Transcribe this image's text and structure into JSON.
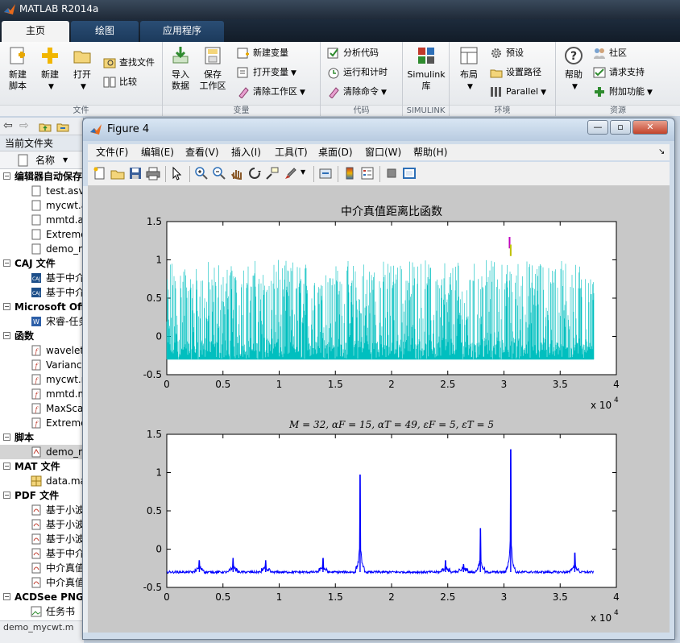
{
  "app": {
    "title": "MATLAB R2014a"
  },
  "tabs": [
    "主页",
    "绘图",
    "应用程序"
  ],
  "ribbon": {
    "file": {
      "label": "文件",
      "new_script": "新建\n脚本",
      "new": "新建",
      "open": "打开",
      "find_files": "查找文件",
      "compare": "比较"
    },
    "variable": {
      "label": "变量",
      "import": "导入\n数据",
      "save_ws": "保存\n工作区",
      "new_var": "新建变量",
      "open_var": "打开变量",
      "clear_ws": "清除工作区"
    },
    "code": {
      "label": "代码",
      "analyze": "分析代码",
      "run_time": "运行和计时",
      "clear_cmd": "清除命令"
    },
    "simulink": {
      "label": "SIMULINK",
      "lib": "Simulink\n库"
    },
    "env": {
      "label": "环境",
      "layout": "布局",
      "prefs": "预设",
      "set_path": "设置路径",
      "parallel": "Parallel"
    },
    "resources": {
      "label": "资源",
      "help": "帮助",
      "community": "社区",
      "support": "请求支持",
      "addons": "附加功能"
    }
  },
  "left_panel": {
    "title": "当前文件夹",
    "column": "名称",
    "groups": [
      {
        "name": "编辑器自动保存",
        "items": [
          "test.asv",
          "mycwt.a",
          "mmtd.a",
          "Extreme",
          "demo_m"
        ]
      },
      {
        "name": "CAJ 文件",
        "items": [
          "基于中介",
          "基于中介"
        ]
      },
      {
        "name": "Microsoft Off",
        "items": [
          "宋睿-任务"
        ]
      },
      {
        "name": "函数",
        "items": [
          "wavelet",
          "Varianc",
          "mycwt.m",
          "mmtd.m",
          "MaxSca",
          "Extreme"
        ]
      },
      {
        "name": "脚本",
        "items": [
          "demo_m"
        ]
      },
      {
        "name": "MAT 文件",
        "items": [
          "data.ma"
        ]
      },
      {
        "name": "PDF 文件",
        "items": [
          "基于小波",
          "基于小波",
          "基于小波",
          "基于中介",
          "中介真值",
          "中介真值"
        ]
      },
      {
        "name": "ACDSee PNG",
        "items": [
          "任务书"
        ]
      }
    ],
    "selected_group": 4,
    "status": "demo_mycwt.m"
  },
  "figure": {
    "title": "Figure 4",
    "menus": [
      "文件(F)",
      "编辑(E)",
      "查看(V)",
      "插入(I)",
      "工具(T)",
      "桌面(D)",
      "窗口(W)",
      "帮助(H)"
    ],
    "window_buttons": {
      "min": "—",
      "max": "▫",
      "close": "✕"
    }
  },
  "chart_data": [
    {
      "type": "line",
      "title": "中介真值距离比函数",
      "xlabel": "",
      "ylabel": "",
      "xlim": [
        0,
        40000
      ],
      "ylim": [
        -0.5,
        1.5
      ],
      "x_ticks": [
        "0",
        "0.5",
        "1",
        "1.5",
        "2",
        "2.5",
        "3",
        "3.5",
        "4"
      ],
      "y_ticks": [
        "-0.5",
        "0",
        "0.5",
        "1",
        "1.5"
      ],
      "x_exponent": "x 10",
      "x_exponent_power": "4",
      "series": [
        {
          "color": "#00bfbf",
          "baseline": -0.3,
          "x": [
            0,
            38000
          ],
          "peak_level": 1.0,
          "density": "dense spikes"
        },
        {
          "color": "#bf00bf",
          "x": [
            30500
          ],
          "values": [
            1.3
          ]
        },
        {
          "color": "#bfbf00",
          "x": [
            30600
          ],
          "values": [
            1.2
          ]
        }
      ]
    },
    {
      "type": "line",
      "title": "M = 32, αF = 15, αT = 49, εF = 5, εT = 5",
      "xlabel": "",
      "ylabel": "",
      "xlim": [
        0,
        40000
      ],
      "ylim": [
        -0.5,
        1.5
      ],
      "x_ticks": [
        "0",
        "0.5",
        "1",
        "1.5",
        "2",
        "2.5",
        "3",
        "3.5",
        "4"
      ],
      "y_ticks": [
        "-0.5",
        "0",
        "0.5",
        "1",
        "1.5"
      ],
      "x_exponent": "x 10",
      "x_exponent_power": "4",
      "series": [
        {
          "color": "#0000ff",
          "baseline": -0.3,
          "x": [
            0,
            38000
          ],
          "peaks": [
            {
              "x": 2900,
              "y": -0.15
            },
            {
              "x": 5900,
              "y": -0.12
            },
            {
              "x": 8800,
              "y": -0.15
            },
            {
              "x": 13900,
              "y": -0.12
            },
            {
              "x": 17200,
              "y": 0.97
            },
            {
              "x": 24800,
              "y": -0.15
            },
            {
              "x": 26400,
              "y": -0.2
            },
            {
              "x": 27900,
              "y": 0.27
            },
            {
              "x": 30600,
              "y": 1.3
            },
            {
              "x": 36300,
              "y": -0.05
            }
          ]
        }
      ]
    }
  ]
}
